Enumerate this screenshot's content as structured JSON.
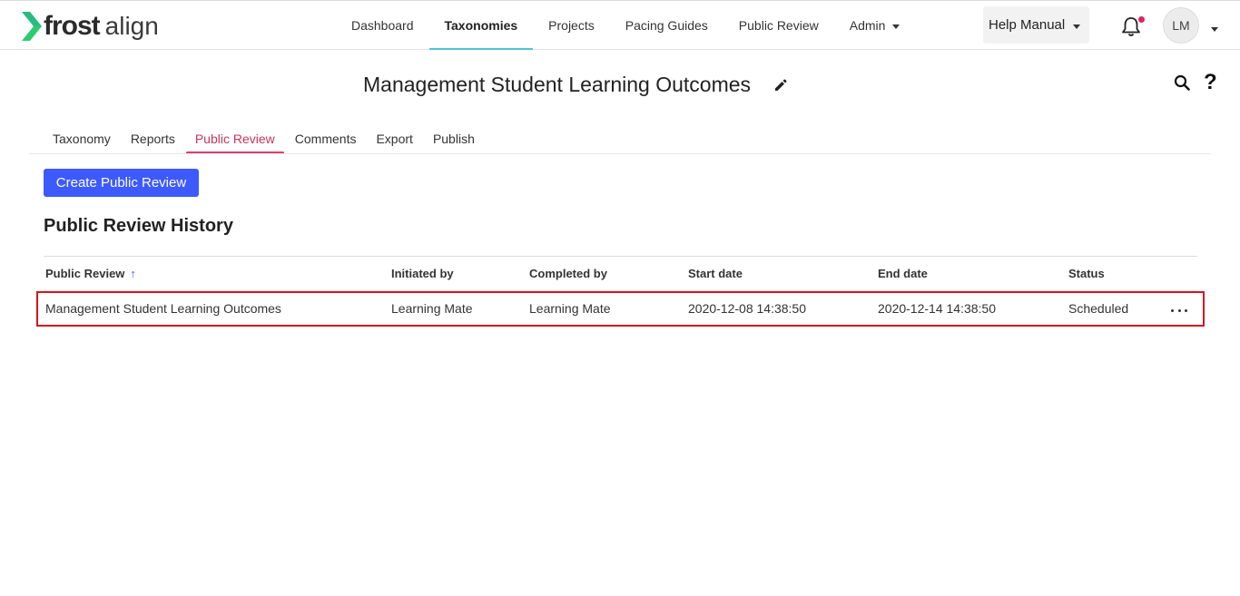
{
  "brand": {
    "name_bold": "frost",
    "name_light": "align",
    "logo_icon": "chevron-logo-icon",
    "accent_color": "#2ecc71"
  },
  "topnav": {
    "items": [
      {
        "label": "Dashboard"
      },
      {
        "label": "Taxonomies",
        "active": true
      },
      {
        "label": "Projects"
      },
      {
        "label": "Pacing Guides"
      },
      {
        "label": "Public Review"
      },
      {
        "label": "Admin",
        "has_dropdown": true
      }
    ],
    "help_label": "Help Manual",
    "notification_icon": "bell-icon",
    "user_initials": "LM"
  },
  "page": {
    "title": "Management Student Learning Outcomes",
    "edit_icon": "pencil-icon",
    "search_icon": "search-icon",
    "help_icon": "question-icon"
  },
  "tabs": [
    {
      "label": "Taxonomy"
    },
    {
      "label": "Reports"
    },
    {
      "label": "Public Review",
      "active": true
    },
    {
      "label": "Comments"
    },
    {
      "label": "Export"
    },
    {
      "label": "Publish"
    }
  ],
  "create_button_label": "Create Public Review",
  "history": {
    "title": "Public Review History",
    "columns": [
      "Public Review",
      "Initiated by",
      "Completed by",
      "Start date",
      "End date",
      "Status"
    ],
    "sort_indicator": "↑",
    "rows": [
      {
        "public_review": "Management Student Learning Outcomes",
        "initiated_by": "Learning Mate",
        "completed_by": "Learning Mate",
        "start_date": "2020-12-08 14:38:50",
        "end_date": "2020-12-14 14:38:50",
        "status": "Scheduled"
      }
    ]
  },
  "colors": {
    "primary_button": "#3d5afe",
    "active_tab": "#c8355a",
    "active_nav_underline": "#4fc3d9",
    "highlight_border": "#d4151f"
  }
}
